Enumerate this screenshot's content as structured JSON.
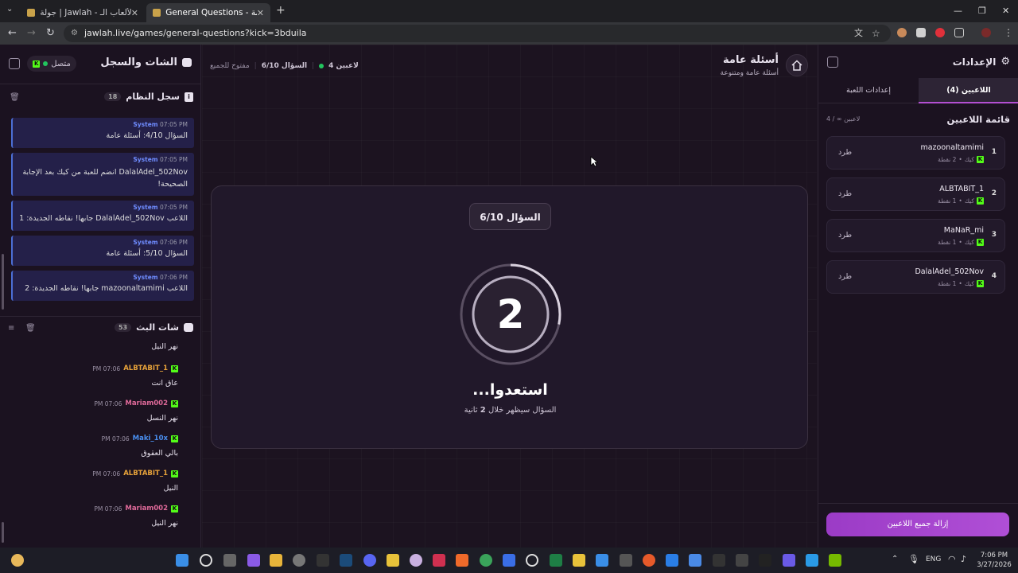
{
  "browser": {
    "tabs": [
      {
        "title": "جولة | Jawlah - منصة الألعاب الـ..."
      },
      {
        "title": "General Questions - أسئلة عامة"
      }
    ],
    "url": "jawlah.live/games/general-questions?kick=3bduila"
  },
  "left_panel": {
    "title": "الشات والسجل",
    "status": "متصل",
    "system_log": {
      "title": "سجل النظام",
      "count": "18",
      "messages": [
        {
          "sender": "System",
          "time": "07:05 PM",
          "text": "السؤال 4/10: أسئلة عامة"
        },
        {
          "sender": "System",
          "time": "07:05 PM",
          "text": "DalalAdel_502Nov انضم للعبة من كيك بعد الإجابة الصحيحة!"
        },
        {
          "sender": "System",
          "time": "07:05 PM",
          "text": "اللاعب DalalAdel_502Nov جابها! نقاطه الجديدة: 1"
        },
        {
          "sender": "System",
          "time": "07:06 PM",
          "text": "السؤال 5/10: أسئلة عامة"
        },
        {
          "sender": "System",
          "time": "07:06 PM",
          "text": "اللاعب mazoonaltamimi جابها! نقاطه الجديدة: 2"
        }
      ]
    },
    "stream_chat": {
      "title": "شات البث",
      "count": "53",
      "first_text": "نهر النيل",
      "messages": [
        {
          "user": "ALBTABIT_1",
          "time": "07:06 PM",
          "text": "عاق انت",
          "color": "#e8a33a"
        },
        {
          "user": "Mariam002",
          "time": "07:06 PM",
          "text": "نهر النسل",
          "color": "#e06a9a"
        },
        {
          "user": "Maki_10x",
          "time": "07:06 PM",
          "text": "بالي العقوق",
          "color": "#4a8ff0"
        },
        {
          "user": "ALBTABIT_1",
          "time": "07:06 PM",
          "text": "النيل",
          "color": "#e8a33a"
        },
        {
          "user": "Mariam002",
          "time": "07:06 PM",
          "text": "نهر النيل",
          "color": "#e06a9a"
        }
      ]
    }
  },
  "center": {
    "game_title": "أسئلة عامة",
    "game_subtitle": "أسئلة عامة ومتنوعة",
    "players_count": "4 لاعبين",
    "question_progress": "السؤال 6/10",
    "open_label": "مفتوح للجميع",
    "card": {
      "question_pill": "السؤال 6/10",
      "countdown": "2",
      "heading": "استعدوا...",
      "sub_before": "السؤال سيظهر خلال",
      "sub_number": "2",
      "sub_after": "ثانية"
    }
  },
  "right_panel": {
    "title": "الإعدادات",
    "tabs": [
      {
        "label": "اللاعبين (4)"
      },
      {
        "label": "إعدادات اللعبة"
      }
    ],
    "players_title": "قائمة اللاعبين",
    "players_meta": "4 / ∞ لاعبين",
    "kick_label": "طرد",
    "source_label": "كيك",
    "players": [
      {
        "rank": "1",
        "name": "mazoonaltamimi",
        "points": "2 نقطة"
      },
      {
        "rank": "2",
        "name": "ALBTABIT_1",
        "points": "1 نقطة"
      },
      {
        "rank": "3",
        "name": "MaNaR_mi",
        "points": "1 نقطة"
      },
      {
        "rank": "4",
        "name": "DalalAdel_502Nov",
        "points": "1 نقطة"
      }
    ],
    "remove_all": "إزالة جميع اللاعبين"
  },
  "taskbar": {
    "lang": "ENG",
    "time": "7:06 PM",
    "date": "3/27/2026"
  },
  "colors": {
    "accent": "#b04fd6",
    "kick_green": "#53fc18",
    "online": "#22c55e"
  }
}
